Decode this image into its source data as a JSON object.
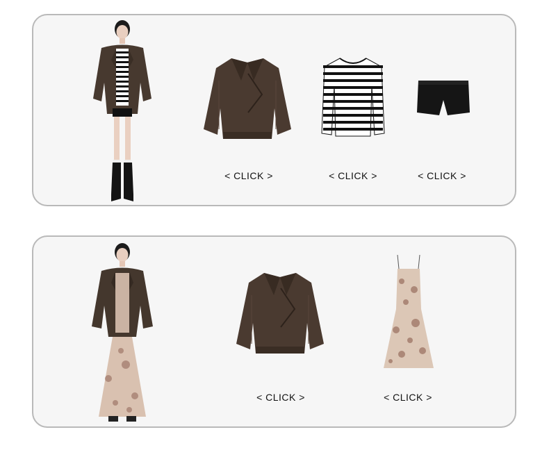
{
  "outfits": [
    {
      "model": "model-leather-jacket-stripe-top-shorts-boots",
      "items": [
        {
          "name": "brown-leather-jacket",
          "cta": "< CLICK >"
        },
        {
          "name": "striped-long-sleeve-top",
          "cta": "< CLICK >"
        },
        {
          "name": "black-denim-shorts",
          "cta": "< CLICK >"
        }
      ]
    },
    {
      "model": "model-leather-jacket-floral-dress",
      "items": [
        {
          "name": "brown-leather-jacket",
          "cta": "< CLICK >"
        },
        {
          "name": "floral-slip-dress",
          "cta": "< CLICK >"
        }
      ]
    }
  ],
  "colors": {
    "card_bg": "#f6f6f6",
    "card_border": "#b9b9b9",
    "leather": "#4a3a30",
    "floral": "#d9c1b0"
  }
}
